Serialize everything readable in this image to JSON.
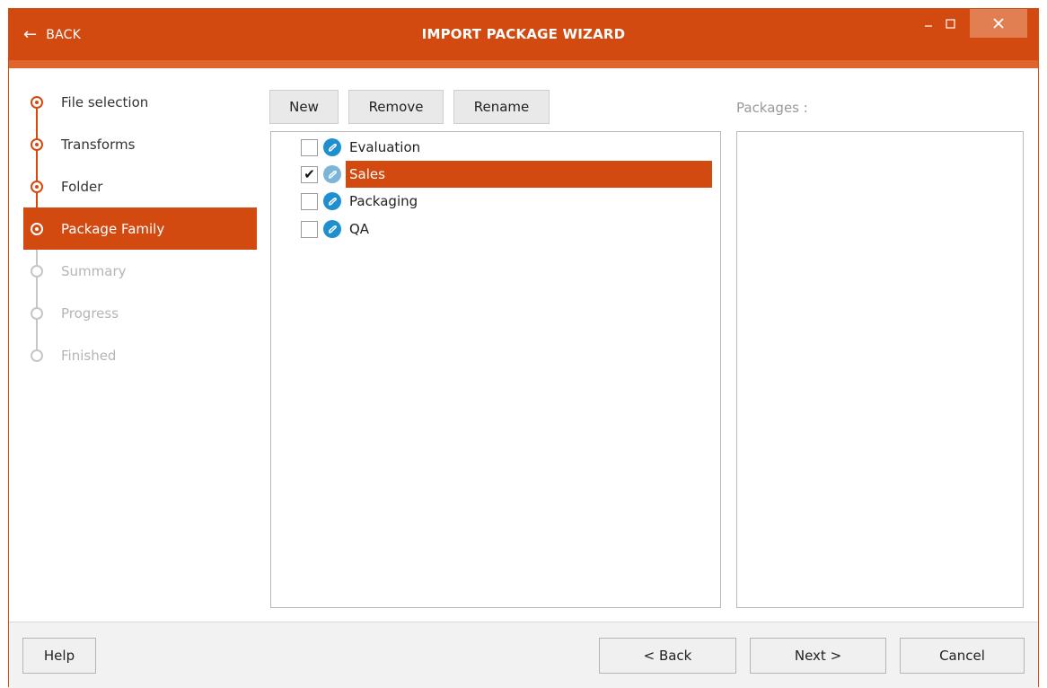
{
  "window": {
    "title": "IMPORT PACKAGE WIZARD",
    "back_label": "BACK",
    "accent_color": "#d34a10"
  },
  "steps": [
    {
      "label": "File selection",
      "state": "done"
    },
    {
      "label": "Transforms",
      "state": "done"
    },
    {
      "label": "Folder",
      "state": "done"
    },
    {
      "label": "Package Family",
      "state": "active"
    },
    {
      "label": "Summary",
      "state": "future"
    },
    {
      "label": "Progress",
      "state": "future"
    },
    {
      "label": "Finished",
      "state": "future"
    }
  ],
  "toolbar": {
    "new_label": "New",
    "remove_label": "Remove",
    "rename_label": "Rename"
  },
  "families": [
    {
      "label": "Evaluation",
      "checked": false,
      "selected": false
    },
    {
      "label": "Sales",
      "checked": true,
      "selected": true
    },
    {
      "label": "Packaging",
      "checked": false,
      "selected": false
    },
    {
      "label": "QA",
      "checked": false,
      "selected": false
    }
  ],
  "packages": {
    "label": "Packages :"
  },
  "footer": {
    "help_label": "Help",
    "back_label": "< Back",
    "next_label": "Next >",
    "cancel_label": "Cancel"
  },
  "icons": {
    "back": "arrow-left-icon",
    "minimize": "minimize-icon",
    "maximize": "maximize-icon",
    "close": "close-icon",
    "family": "package-family-icon",
    "step": "step-circle-icon"
  }
}
